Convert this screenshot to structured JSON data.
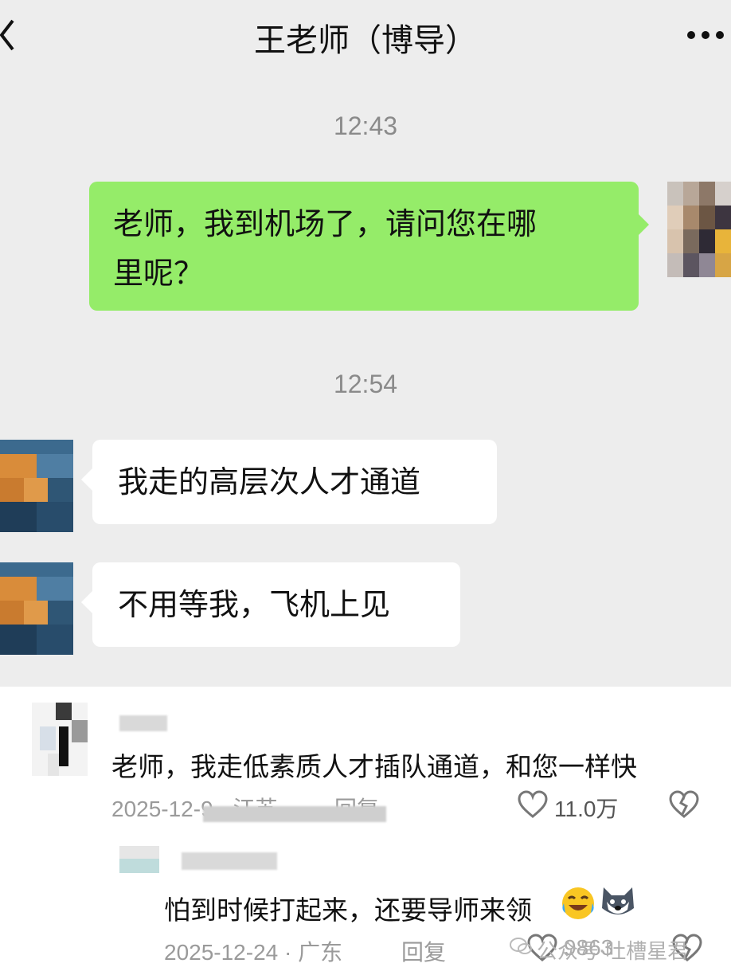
{
  "header": {
    "title": "王老师（博导）"
  },
  "messages": [
    {
      "time": "12:43"
    },
    {
      "text_line1": "老师，我到机场了，请问您在哪",
      "text_line2": "里呢？"
    },
    {
      "time": "12:54"
    },
    {
      "text": "我走的高层次人才通道"
    },
    {
      "text": "不用等我，飞机上见"
    }
  ],
  "comments": [
    {
      "text": "老师，我走低素质人才插队通道，和您一样快",
      "meta": "2025-12-9 · 江苏",
      "reply_label": "回复",
      "likes": "11.0万"
    },
    {
      "text": "怕到时候打起来，还要导师来领",
      "meta": "2025-12-24 · 广东",
      "reply_label": "回复",
      "likes": "9863"
    }
  ],
  "watermark": "公众号·吐槽星君",
  "colors": {
    "sent_bubble": "#95ec69",
    "recv_bubble": "#ffffff",
    "chat_bg": "#ededed"
  }
}
